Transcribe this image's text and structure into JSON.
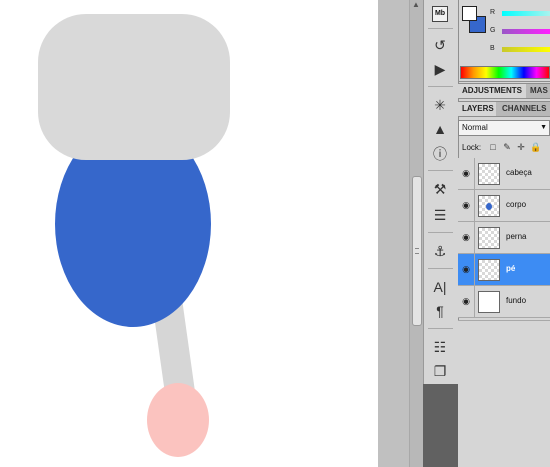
{
  "canvas": {
    "shapes": [
      "head",
      "body",
      "leg",
      "foot"
    ]
  },
  "colors": {
    "head": "#d9d9d9",
    "body": "#3667cb",
    "leg": "#d6d6d6",
    "foot": "#fbc3bf",
    "foreground": "#ffffff",
    "background": "#3667cb",
    "selected_layer": "#3d8cf3"
  },
  "tools": {
    "mb_label": "Mb",
    "icons": [
      "mini-bridge-icon",
      "history-icon",
      "actions-icon",
      "brushes-icon",
      "histogram-icon",
      "info-icon",
      "tool-presets-icon",
      "layer-comps-icon",
      "clone-source-icon",
      "character-icon",
      "paragraph-icon",
      "notes-icon",
      "copy-source-icon"
    ]
  },
  "color_panel": {
    "r_label": "R",
    "g_label": "G",
    "b_label": "B"
  },
  "adjustments_tabs": [
    {
      "label": "ADJUSTMENTS",
      "active": true
    },
    {
      "label": "MAS",
      "active": false
    }
  ],
  "layers_tabs": [
    {
      "label": "LAYERS",
      "active": true
    },
    {
      "label": "CHANNELS",
      "active": false
    }
  ],
  "blend_mode": "Normal",
  "lock_label": "Lock:",
  "layers": [
    {
      "name": "cabeça",
      "selected": false,
      "thumb": "transparent"
    },
    {
      "name": "corpo",
      "selected": false,
      "thumb": "dot"
    },
    {
      "name": "perna",
      "selected": false,
      "thumb": "transparent"
    },
    {
      "name": "pé",
      "selected": true,
      "thumb": "transparent"
    },
    {
      "name": "fundo",
      "selected": false,
      "thumb": "white"
    }
  ]
}
